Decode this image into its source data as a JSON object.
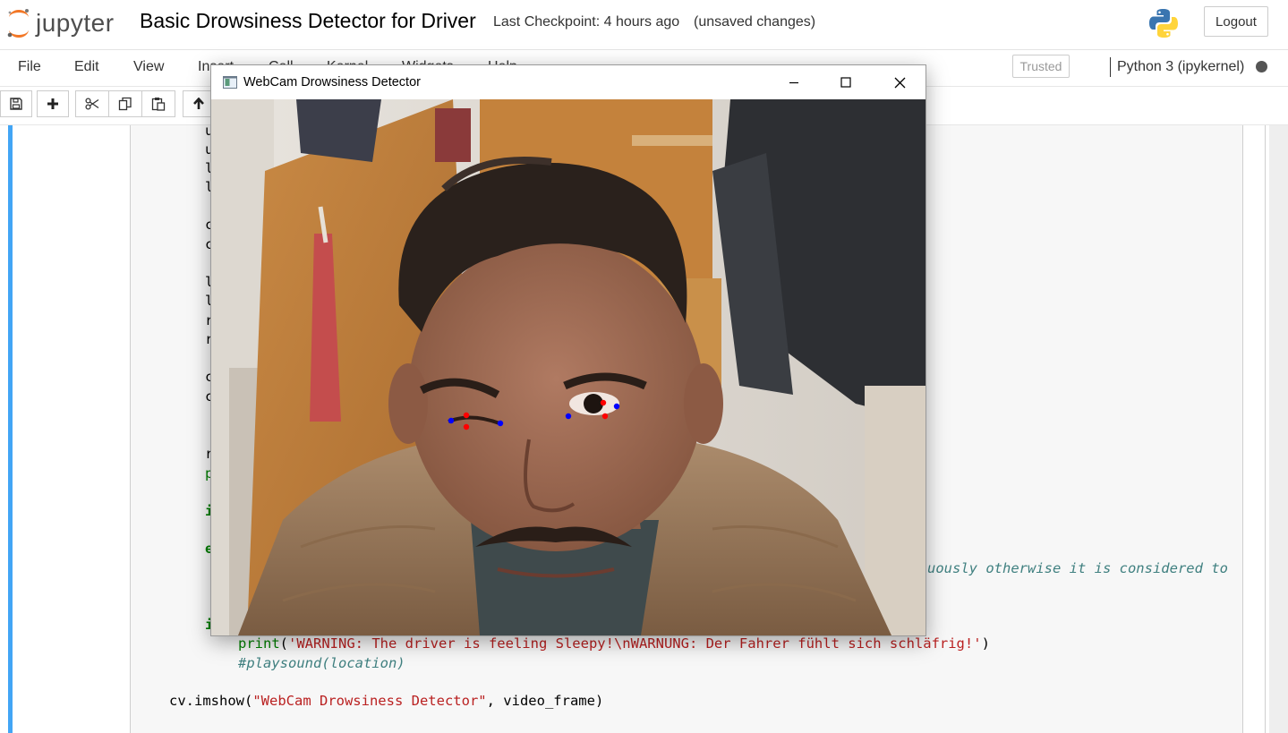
{
  "header": {
    "logo_text": "jupyter",
    "notebook_title": "Basic Drowsiness Detector for Driver",
    "checkpoint": "Last Checkpoint: 4 hours ago",
    "save_status": "(unsaved changes)",
    "logout_label": "Logout"
  },
  "menubar": {
    "items": [
      "File",
      "Edit",
      "View",
      "Insert",
      "Cell",
      "Kernel",
      "Widgets",
      "Help"
    ],
    "trusted_label": "Trusted",
    "kernel_name": "Python 3 (ipykernel)"
  },
  "toolbar": {
    "buttons": [
      "save-icon",
      "plus-icon",
      "scissors-icon",
      "copy-icon",
      "paste-icon",
      "arrow-up-icon"
    ]
  },
  "code": {
    "left_fragments": [
      "u",
      "u",
      "l",
      "l",
      "c",
      "c",
      "l",
      "l",
      "r",
      "r",
      "c",
      "c",
      "r",
      "p",
      "i",
      "e",
      "i"
    ],
    "comment_tail": "uously otherwise it is considered to",
    "print_func": "print",
    "print_string": "'WARNING: The driver is feeling Sleepy!\\nWARNUNG: Der Fahrer fühlt sich schläfrig!'",
    "playsound_comment": "#playsound(location)",
    "imshow_func": "cv.imshow(",
    "imshow_string": "\"WebCam Drowsiness Detector\"",
    "imshow_rest": ", video_frame)"
  },
  "cv_window": {
    "title": "WebCam Drowsiness Detector",
    "landmark_colors": {
      "corner": "#0000ff",
      "lid": "#ff0000"
    }
  }
}
